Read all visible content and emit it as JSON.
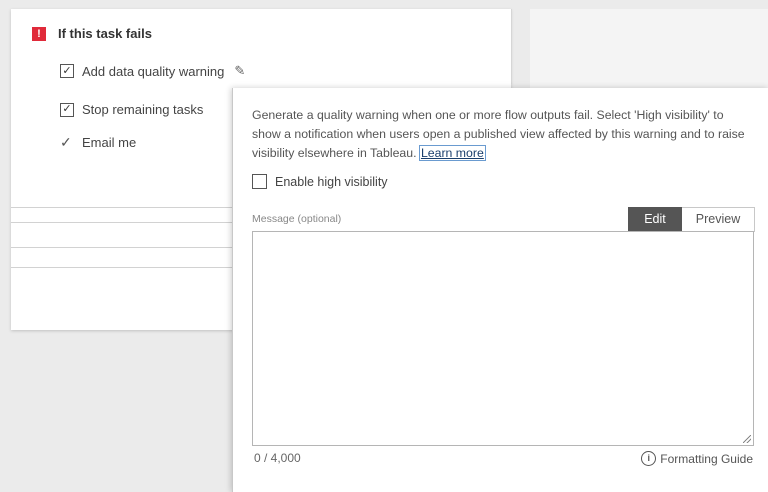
{
  "task_failure": {
    "header_icon": "alert-icon",
    "header_icon_glyph": "!",
    "title": "If this task fails",
    "options": [
      {
        "label": "Add data quality warning",
        "checked": true,
        "icon": "pencil-icon"
      },
      {
        "label": "Stop remaining tasks",
        "checked": true
      },
      {
        "label": "Email me",
        "checked": true
      }
    ]
  },
  "popover": {
    "description": "Generate a quality warning when one or more flow outputs fail. Select 'High visibility' to show a notification when users open a published view affected by this warning and to raise visibility elsewhere in Tableau.",
    "learn_more_label": "Learn more",
    "high_visibility_label": "Enable high visibility",
    "high_visibility_checked": false,
    "message_label": "Message (optional)",
    "message_value": "",
    "tabs": [
      {
        "label": "Edit",
        "active": true
      },
      {
        "label": "Preview",
        "active": false
      }
    ],
    "char_count": "0 / 4,000",
    "formatting_guide_label": "Formatting Guide",
    "formatting_guide_icon": "info-icon"
  },
  "colors": {
    "alert_red": "#e02a3a",
    "active_tab": "#555555",
    "link": "#1a3e6c"
  }
}
